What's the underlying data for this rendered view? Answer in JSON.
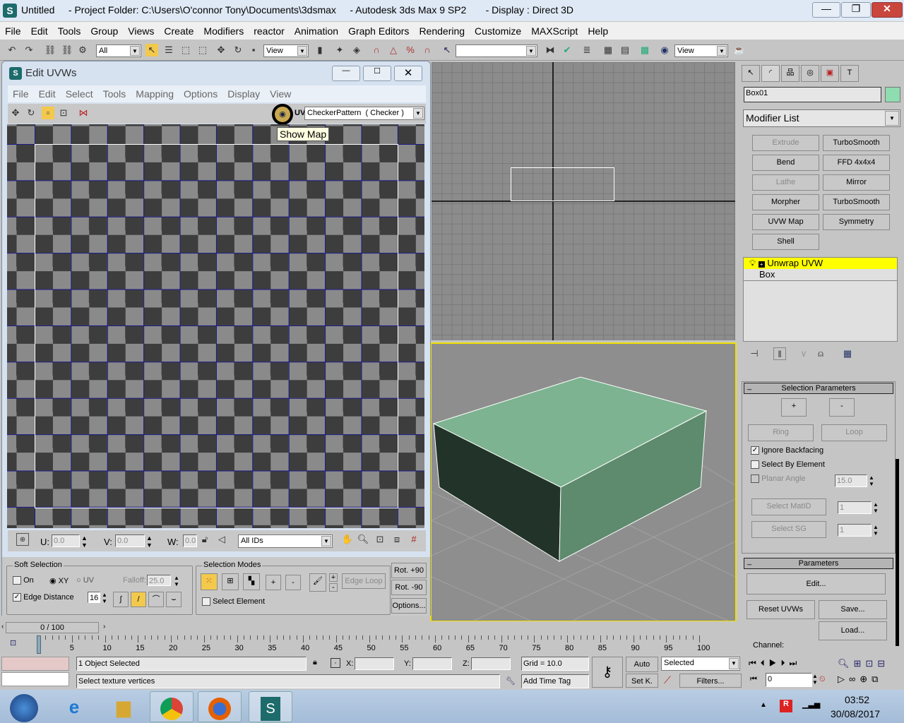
{
  "window": {
    "title": "Untitled     - Project Folder: C:\\Users\\O'connor Tony\\Documents\\3dsmax     - Autodesk 3ds Max 9 SP2       - Display : Direct 3D"
  },
  "menu": [
    "File",
    "Edit",
    "Tools",
    "Group",
    "Views",
    "Create",
    "Modifiers",
    "reactor",
    "Animation",
    "Graph Editors",
    "Rendering",
    "Customize",
    "MAXScript",
    "Help"
  ],
  "toolbar": {
    "selection_filter": "All",
    "ref_coord": "View",
    "named_selection": "",
    "view2": "View"
  },
  "uvw_dialog": {
    "title": "Edit UVWs",
    "menu": [
      "File",
      "Edit",
      "Select",
      "Tools",
      "Mapping",
      "Options",
      "Display",
      "View"
    ],
    "map_combo": "CheckerPattern  ( Checker )",
    "uv_label": "UV",
    "tooltip": "Show Map",
    "u_label": "U:",
    "u_value": "0.0",
    "v_label": "V:",
    "v_value": "0.0",
    "w_label": "W:",
    "w_value": "0.0",
    "ids_combo": "All IDs",
    "soft_selection": {
      "title": "Soft Selection",
      "on_label": "On",
      "on": false,
      "xy_label": "XY",
      "uv_label": "UV",
      "mode": "XY",
      "falloff_label": "Falloff:",
      "falloff": "25.0",
      "edge_distance_label": "Edge Distance",
      "edge_distance": true,
      "edge_value": "16"
    },
    "selection_modes": {
      "title": "Selection Modes",
      "plus": "+",
      "minus": "-",
      "edge_loop": "Edge Loop",
      "select_element_label": "Select Element",
      "select_element": false
    },
    "rot_plus": "Rot. +90",
    "rot_minus": "Rot. -90",
    "options": "Options..."
  },
  "command_panel": {
    "object_name": "Box01",
    "object_color": "#8fdcb0",
    "modifier_list": "Modifier List",
    "modifier_buttons": [
      {
        "label": "Extrude",
        "enabled": false
      },
      {
        "label": "TurboSmooth",
        "enabled": true
      },
      {
        "label": "Bend",
        "enabled": true
      },
      {
        "label": "FFD 4x4x4",
        "enabled": true
      },
      {
        "label": "Lathe",
        "enabled": false
      },
      {
        "label": "Mirror",
        "enabled": true
      },
      {
        "label": "Morpher",
        "enabled": true
      },
      {
        "label": "TurboSmooth",
        "enabled": true
      },
      {
        "label": "UVW Map",
        "enabled": true
      },
      {
        "label": "Symmetry",
        "enabled": true
      },
      {
        "label": "Shell",
        "enabled": true
      }
    ],
    "stack": [
      "Unwrap UVW",
      "Box"
    ],
    "selection_parameters": {
      "title": "Selection Parameters",
      "plus": "+",
      "minus": "-",
      "ring": "Ring",
      "loop": "Loop",
      "ignore_backfacing": "Ignore Backfacing",
      "ignore_backfacing_checked": true,
      "select_by_element": "Select By Element",
      "select_by_element_checked": false,
      "planar_angle": "Planar Angle",
      "planar_angle_value": "15.0",
      "select_matid": "Select MatID",
      "matid_value": "1",
      "select_sg": "Select SG",
      "sg_value": "1"
    },
    "parameters": {
      "title": "Parameters",
      "edit": "Edit...",
      "reset": "Reset UVWs",
      "save": "Save...",
      "load": "Load...",
      "channel": "Channel:"
    }
  },
  "timeline": {
    "frame": "0 / 100",
    "ticks": [
      "0",
      "5",
      "10",
      "15",
      "20",
      "25",
      "30",
      "35",
      "40",
      "45",
      "50",
      "55",
      "60",
      "65",
      "70",
      "75",
      "80",
      "85",
      "90",
      "95",
      "100"
    ]
  },
  "status": {
    "selected": "1 Object Selected",
    "prompt": "Select texture vertices",
    "x_label": "X:",
    "y_label": "Y:",
    "z_label": "Z:",
    "grid": "Grid = 10.0",
    "add_time_tag": "Add Time Tag",
    "auto": "Auto",
    "set_key": "Set K.",
    "key_filter": "Selected",
    "filters": "Filters...",
    "current_frame": "0"
  },
  "taskbar": {
    "time": "03:52",
    "date": "30/08/2017"
  },
  "colors": {
    "viewport_active_border": "#f0e000",
    "stack_highlight": "#ffff00",
    "box_top": "#7db390"
  }
}
